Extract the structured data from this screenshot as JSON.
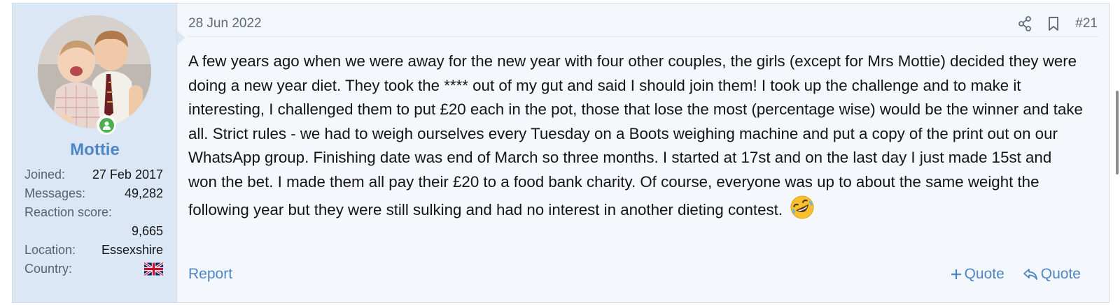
{
  "user": {
    "name": "Mottie",
    "avatar_icon": "avatar-photo",
    "online_icon": "online-status-icon",
    "stats": {
      "joined_label": "Joined:",
      "joined_value": "27 Feb 2017",
      "messages_label": "Messages:",
      "messages_value": "49,282",
      "reaction_label": "Reaction score:",
      "reaction_value": "9,665",
      "location_label": "Location:",
      "location_value": "Essexshire",
      "country_label": "Country:",
      "country_flag_icon": "uk-flag-icon"
    }
  },
  "post": {
    "date": "28 Jun 2022",
    "number": "#21",
    "body": "A few years ago when we were away for the new year with four other couples, the girls (except for Mrs Mottie) decided they were doing a new year diet. They took the **** out of my gut and said I should join them! I took up the challenge and to make it interesting, I challenged them to put £20 each in the pot, those that lose the most (percentage wise) would be the winner and take all. Strict rules - we had to weigh ourselves every Tuesday on a Boots weighing machine and put a copy of the print out on our WhatsApp group. Finishing date was end of March so three months. I started at 17st and on the last day I just made 15st and won the bet. I made them all pay their £20 to a food bank charity. Of course, everyone was up to about the same weight the following year but they were still sulking and had no interest in another dieting contest.",
    "emoji_icon": "rolling-laughing-emoji"
  },
  "actions": {
    "share_icon": "share-icon",
    "bookmark_icon": "bookmark-icon",
    "report_label": "Report",
    "multiquote_label": "Quote",
    "reply_quote_label": "Quote"
  },
  "colors": {
    "accent": "#4f86c6",
    "user_cell_bg": "#dce7f5",
    "post_bg": "#f4f7fb",
    "online": "#4caf50"
  }
}
